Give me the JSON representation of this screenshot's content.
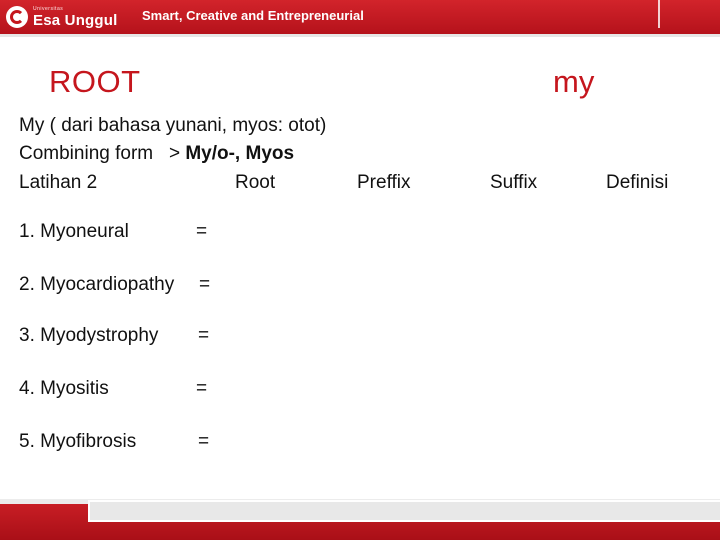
{
  "header": {
    "logo_small": "Universitas",
    "logo_name": "Esa Unggul",
    "tagline": "Smart, Creative and Entrepreneurial"
  },
  "title": {
    "left": "ROOT",
    "right": "my"
  },
  "intro": {
    "line1": "My ( dari bahasa yunani, myos: otot)",
    "combining_prefix": "Combining form   > ",
    "combining_bold": "My/o-, Myos"
  },
  "exercise": {
    "label": "Latihan 2",
    "columns": [
      "Root",
      "Preffix",
      "Suffix",
      "Definisi"
    ]
  },
  "items": [
    {
      "term": "1. Myoneural",
      "eq": "="
    },
    {
      "term": "2. Myocardiopathy",
      "eq": "="
    },
    {
      "term": "3. Myodystrophy",
      "eq": "="
    },
    {
      "term": "4. Myositis",
      "eq": "="
    },
    {
      "term": "5.  Myofibrosis",
      "eq": "="
    }
  ],
  "colors": {
    "brand_red": "#c5161d"
  }
}
